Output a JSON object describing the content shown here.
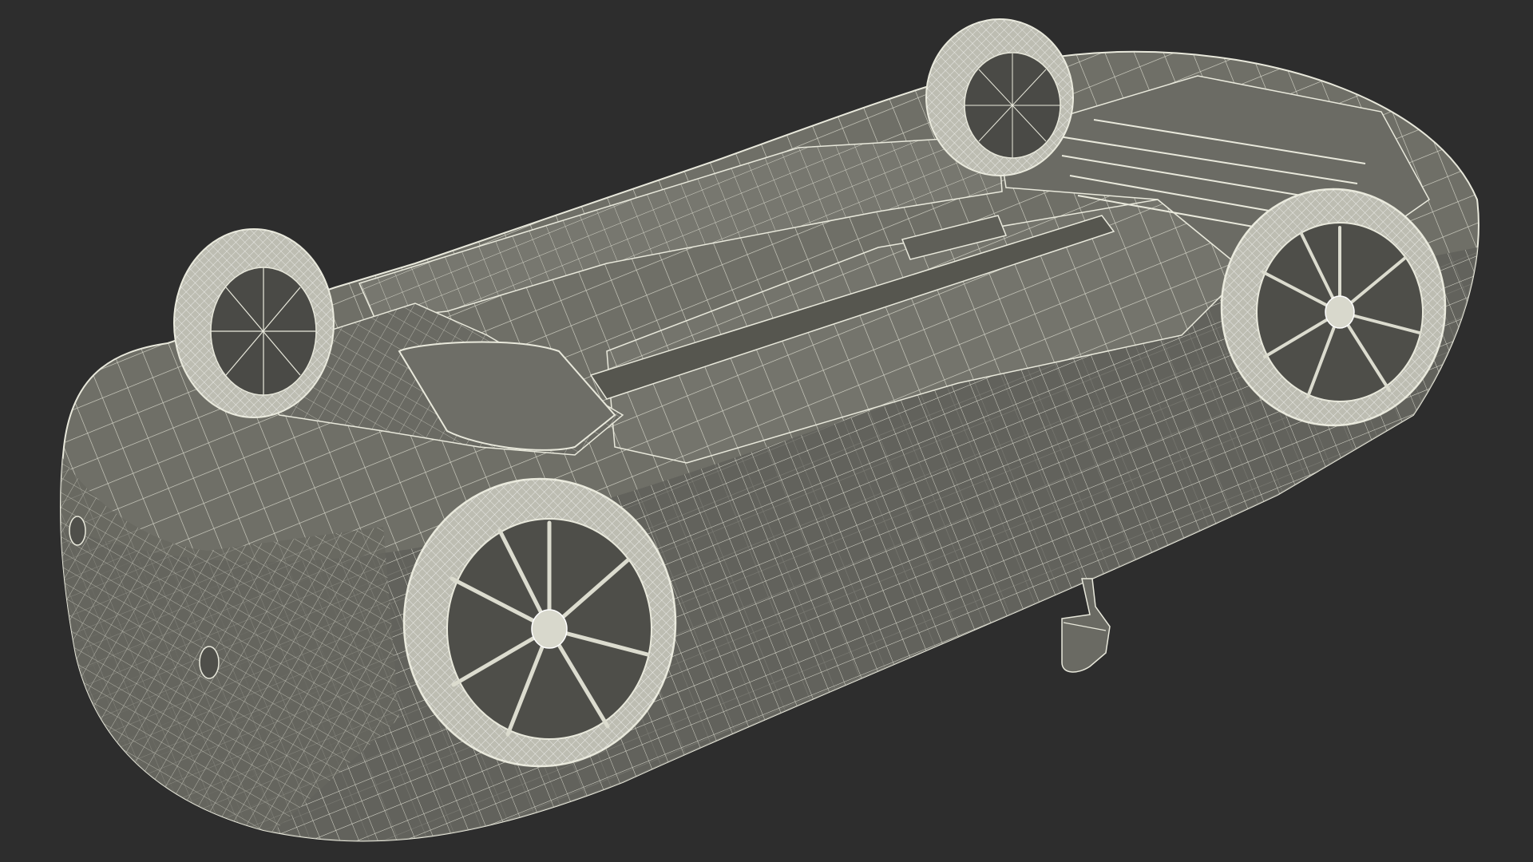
{
  "scene": {
    "subject": "car-3d-wireframe-render",
    "view": "underside",
    "colors": {
      "background": "#2d2d2d",
      "surface": "#6f6f67",
      "surface_dark": "#5b5b55",
      "surface_light": "#85857c",
      "wire": "#e9e9dc",
      "tire": "#bdbdb2",
      "shadow": "#3a3a38"
    }
  }
}
